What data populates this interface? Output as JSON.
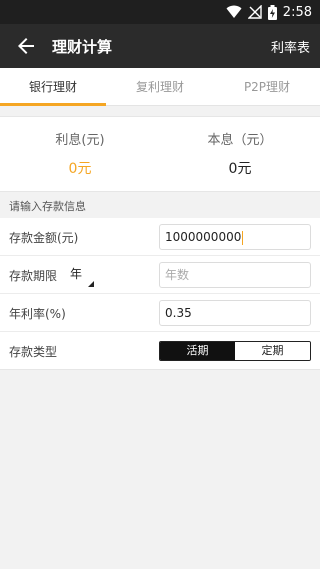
{
  "status": {
    "time": "2:58"
  },
  "appbar": {
    "title": "理财计算",
    "action": "利率表"
  },
  "tabs": [
    {
      "label": "银行理财"
    },
    {
      "label": "复利理财"
    },
    {
      "label": "P2P理财"
    }
  ],
  "summary": {
    "interest_label": "利息(元)",
    "interest_value": "0元",
    "total_label": "本息（元）",
    "total_value": "0元"
  },
  "section_title": "请输入存款信息",
  "form": {
    "amount_label": "存款金额(元)",
    "amount_value": "1000000000",
    "term_label": "存款期限",
    "term_unit": "年",
    "term_placeholder": "年数",
    "rate_label": "年利率(%)",
    "rate_value": "0.35",
    "type_label": "存款类型",
    "type_options": [
      "活期",
      "定期"
    ]
  },
  "colors": {
    "accent": "#f5a623",
    "appbar": "#2b2b2b",
    "statusbar": "#1f1f1f"
  }
}
